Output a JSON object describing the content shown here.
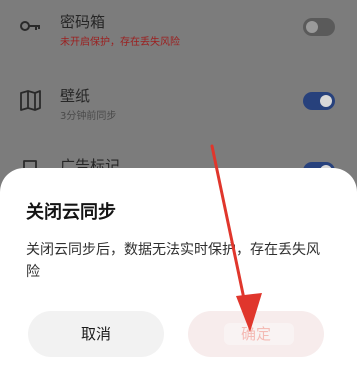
{
  "settings": {
    "items": [
      {
        "icon": "key-icon",
        "title": "密码箱",
        "subtitle": "未开启保护，存在丢失风险",
        "toggle": "off"
      },
      {
        "icon": "book-icon",
        "title": "壁纸",
        "subtitle": "3分钟前同步",
        "toggle": "on"
      },
      {
        "icon": "bookmark-icon",
        "title": "广告标记",
        "subtitle": "",
        "toggle": "on"
      }
    ]
  },
  "dialog": {
    "title": "关闭云同步",
    "message": "关闭云同步后，数据无法实时保护，存在丢失风险",
    "cancel_label": "取消",
    "confirm_label": "确定"
  },
  "colors": {
    "accent": "#e94a3a",
    "annotation_arrow": "#e0362c",
    "toggle_on": "#3463d6"
  }
}
